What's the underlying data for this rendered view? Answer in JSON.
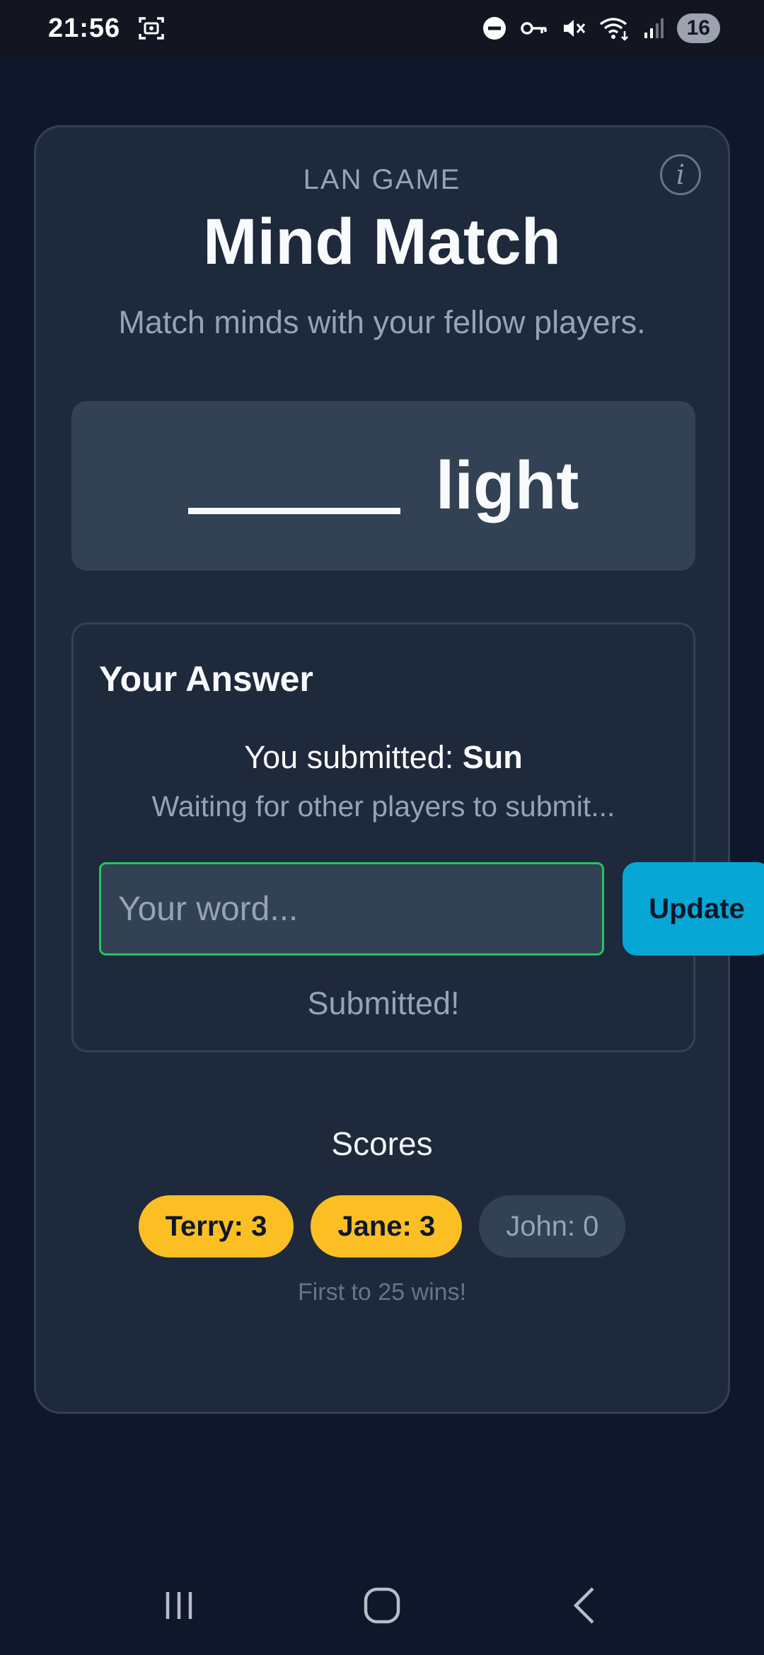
{
  "status_bar": {
    "time": "21:56",
    "battery": "16",
    "icons": [
      "screenshot-icon",
      "dnd-icon",
      "vpn-key-icon",
      "mute-icon",
      "wifi-icon",
      "signal-icon"
    ]
  },
  "header": {
    "eyebrow": "LAN GAME",
    "title": "Mind Match",
    "subtitle": "Match minds with your fellow players.",
    "info_icon": "info-icon"
  },
  "prompt": {
    "word": "light"
  },
  "answer": {
    "heading": "Your Answer",
    "submitted_prefix": "You submitted: ",
    "submitted_word": "Sun",
    "waiting_text": "Waiting for other players to submit...",
    "input_placeholder": "Your word...",
    "input_value": "",
    "update_label": "Update",
    "status_text": "Submitted!"
  },
  "scores": {
    "title": "Scores",
    "players": [
      {
        "label": "Terry: 3",
        "state": "active"
      },
      {
        "label": "Jane: 3",
        "state": "active"
      },
      {
        "label": "John: 0",
        "state": "inactive"
      }
    ],
    "note": "First to 25 wins!"
  },
  "colors": {
    "background": "#0f172a",
    "card": "#1e293b",
    "accent": "#06a7d4",
    "highlight": "#fbbf24",
    "success_border": "#22c55e"
  },
  "nav_bar": {
    "icons": [
      "recent-apps-icon",
      "home-icon",
      "back-icon"
    ]
  }
}
